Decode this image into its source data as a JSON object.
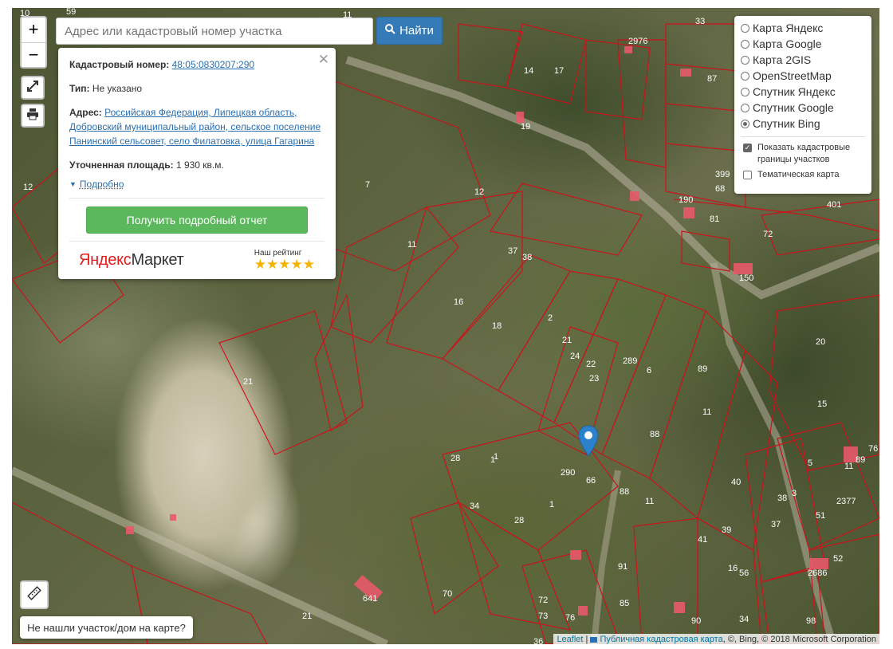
{
  "search": {
    "placeholder": "Адрес или кадастровый номер участка",
    "button_label": "Найти"
  },
  "zoom": {
    "in": "+",
    "out": "−"
  },
  "popup": {
    "cad_label": "Кадастровый номер:",
    "cad_value": "48:05:0830207:290",
    "type_label": "Тип:",
    "type_value": "Не указано",
    "address_label": "Адрес:",
    "address_value": "Российская Федерация, Липецкая область, Добровский муниципальный район, сельское поселение Панинский сельсовет, село Филатовка, улица Гагарина",
    "area_label": "Уточненная площадь:",
    "area_value": "1 930 кв.м.",
    "more_label": "Подробно",
    "report_button": "Получить подробный отчет",
    "brand_yandex": "Яндекс",
    "brand_market": "Маркет",
    "rating_label": "Наш рейтинг",
    "rating_stars": 5
  },
  "layers": {
    "base": [
      {
        "label": "Карта Яндекс",
        "selected": false
      },
      {
        "label": "Карта Google",
        "selected": false
      },
      {
        "label": "Карта 2GIS",
        "selected": false
      },
      {
        "label": "OpenStreetMap",
        "selected": false
      },
      {
        "label": "Спутник Яндекс",
        "selected": false
      },
      {
        "label": "Спутник Google",
        "selected": false
      },
      {
        "label": "Спутник Bing",
        "selected": true
      }
    ],
    "overlays": [
      {
        "label": "Показать кадастровые границы участков",
        "checked": true
      },
      {
        "label": "Тематическая карта",
        "checked": false
      }
    ]
  },
  "notfound_button": "Не нашли участок/дом на карте?",
  "attribution": {
    "leaflet": "Leaflet",
    "sep": " | ",
    "pkk": "Публичная кадастровая карта",
    "rest": ", ©, Bing, © 2018 Microsoft Corporation"
  },
  "map_labels": [
    "10",
    "59",
    "11",
    "33",
    "2976",
    "87",
    "14",
    "17",
    "19",
    "7",
    "12",
    "12",
    "11",
    "399",
    "68",
    "190",
    "401",
    "81",
    "72",
    "150",
    "37",
    "38",
    "16",
    "18",
    "2",
    "21",
    "24",
    "22",
    "23",
    "289",
    "6",
    "89",
    "20",
    "15",
    "21",
    "11",
    "88",
    "290",
    "6",
    "1",
    "28",
    "34",
    "1",
    "28",
    "88",
    "11",
    "41",
    "40",
    "39",
    "38",
    "37",
    "3",
    "51",
    "5",
    "89",
    "76",
    "11",
    "2377",
    "52",
    "2686",
    "56",
    "16",
    "91",
    "85",
    "72",
    "73",
    "76",
    "90",
    "34",
    "98",
    "70",
    "21",
    "36",
    "1",
    "6",
    "641"
  ],
  "colors": {
    "parcel_border": "#d0101a",
    "building": "#e85a6a",
    "accent": "#337ab7",
    "green": "#5cb85c"
  }
}
